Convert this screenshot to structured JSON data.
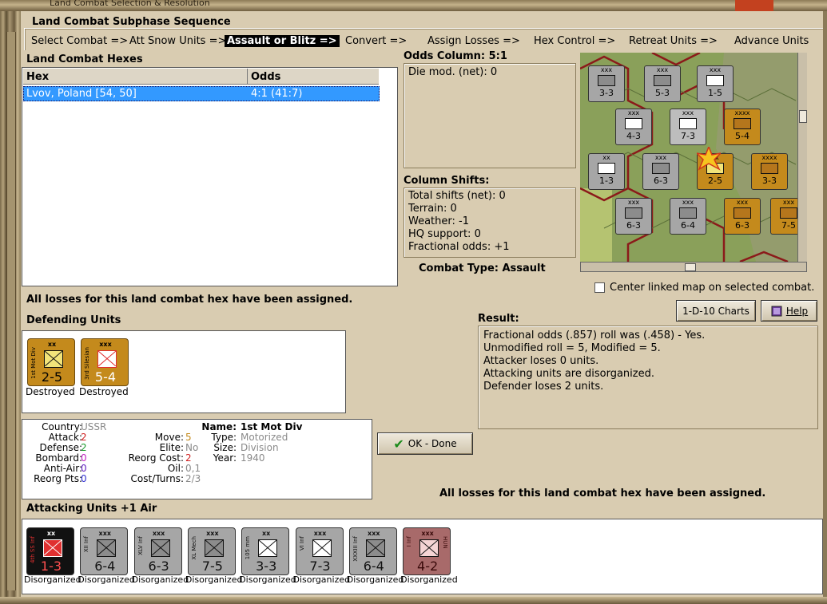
{
  "window": {
    "title": "Land Combat Selection & Resolution"
  },
  "subphase": {
    "title": "Land Combat Subphase Sequence",
    "steps": [
      {
        "label": "Select Combat =>"
      },
      {
        "label": "Att Snow Units =>"
      },
      {
        "label": "Assault or Blitz =>",
        "active": true
      },
      {
        "label": "Convert =>"
      },
      {
        "label": "Assign Losses =>"
      },
      {
        "label": "Hex Control =>"
      },
      {
        "label": "Retreat Units =>"
      },
      {
        "label": "Advance Units"
      }
    ]
  },
  "hexes": {
    "title": "Land Combat Hexes",
    "columns": [
      "Hex",
      "Odds"
    ],
    "rows": [
      {
        "hex": "Lvov, Poland [54, 50]",
        "odds": "4:1 (41:7)",
        "selected": true
      }
    ]
  },
  "odds": {
    "title": "Odds Column: 5:1",
    "die_mod": "Die mod. (net): 0"
  },
  "shifts": {
    "title": "Column Shifts:",
    "lines": [
      "Total shifts (net): 0",
      "Terrain: 0",
      "Weather: -1",
      "HQ support: 0",
      "Fractional odds: +1"
    ]
  },
  "combat_type": "Combat Type:  Assault",
  "center_map": {
    "label": "Center linked map on selected combat.",
    "checked": false
  },
  "buttons": {
    "charts": "1-D-10 Charts",
    "help": "Help",
    "ok": "OK - Done"
  },
  "losses_msg_top": "All losses for this land combat hex have been assigned.",
  "losses_msg_bottom": "All losses for this land combat hex have been assigned.",
  "defending": {
    "title": "Defending Units",
    "units": [
      {
        "side_label": "1st Mot Div",
        "size": "xx",
        "value": "2-5",
        "status": "Destroyed",
        "color": "#c48a1c",
        "symbol_color": "#f2e47a"
      },
      {
        "side_label": "3rd Silesian",
        "size": "xxx",
        "value": "5-4",
        "status": "Destroyed",
        "color": "#c48a1c",
        "symbol_color": "#e03030"
      }
    ]
  },
  "unit_info": {
    "country_label": "Country:",
    "country": "USSR",
    "attack_label": "Attack:",
    "attack": "2",
    "defense_label": "Defense:",
    "defense": "2",
    "bombard_label": "Bombard:",
    "bombard": "0",
    "antiair_label": "Anti-Air:",
    "antiair": "0",
    "reorg_pts_label": "Reorg Pts:",
    "reorg_pts": "0",
    "move_label": "Move:",
    "move": "5",
    "elite_label": "Elite:",
    "elite": "No",
    "reorg_cost_label": "Reorg Cost:",
    "reorg_cost": "2",
    "oil_label": "Oil:",
    "oil": "0,1",
    "cost_turns_label": "Cost/Turns:",
    "cost_turns": "2/3",
    "name_label": "Name:",
    "name": "1st Mot Div",
    "type_label": "Type:",
    "type": "Motorized",
    "size_label": "Size:",
    "size": "Division",
    "year_label": "Year:",
    "year": "1940"
  },
  "result": {
    "title": "Result:",
    "lines": [
      "Fractional odds (.857) roll was (.458)  - Yes.",
      "Unmodified roll = 5, Modified = 5.",
      "Attacker loses 0 units.",
      "Attacking units are disorganized.",
      "Defender loses 2 units."
    ]
  },
  "attacking": {
    "title": "Attacking Units +1 Air",
    "units": [
      {
        "side_label": "4th SS Inf",
        "size": "xx",
        "value": "1-3",
        "status": "Disorganized",
        "color": "#111111",
        "symbol_color": "#e03030"
      },
      {
        "side_label": "XII Inf",
        "size": "xxx",
        "value": "6-4",
        "status": "Disorganized",
        "color": "#a6a6a6",
        "symbol_color": "#8c8c8c"
      },
      {
        "side_label": "XLV Inf",
        "size": "xxx",
        "value": "6-3",
        "status": "Disorganized",
        "color": "#a6a6a6",
        "symbol_color": "#8c8c8c"
      },
      {
        "side_label": "XL Mech",
        "size": "xxx",
        "value": "7-5",
        "status": "Disorganized",
        "color": "#a6a6a6",
        "symbol_color": "#8c8c8c"
      },
      {
        "side_label": "105 mm",
        "size": "xx",
        "value": "3-3",
        "status": "Disorganized",
        "color": "#a6a6a6",
        "symbol_color": "#ffffff"
      },
      {
        "side_label": "VI Inf",
        "size": "xxx",
        "value": "7-3",
        "status": "Disorganized",
        "color": "#a6a6a6",
        "symbol_color": "#ffffff"
      },
      {
        "side_label": "XXXIII Inf",
        "size": "xxx",
        "value": "6-4",
        "status": "Disorganized",
        "color": "#a6a6a6",
        "symbol_color": "#8c8c8c"
      },
      {
        "side_label": "I Inf",
        "size": "xxx",
        "value": "4-2",
        "status": "Disorganized",
        "color": "#a86a6a",
        "symbol_color": "#f4d4d4",
        "corner_label": "HUN"
      }
    ]
  },
  "map": {
    "counters": [
      {
        "label": "3-3"
      },
      {
        "label": "5-3"
      },
      {
        "label": "1-5"
      },
      {
        "label": "4-3"
      },
      {
        "label": "7-3"
      },
      {
        "label": "5-4"
      },
      {
        "label": "1-3"
      },
      {
        "label": "6-3"
      },
      {
        "label": "2-5"
      },
      {
        "label": "3-3"
      },
      {
        "label": "6-3"
      },
      {
        "label": "6-4"
      },
      {
        "label": "6-3"
      },
      {
        "label": "7-5"
      }
    ]
  }
}
